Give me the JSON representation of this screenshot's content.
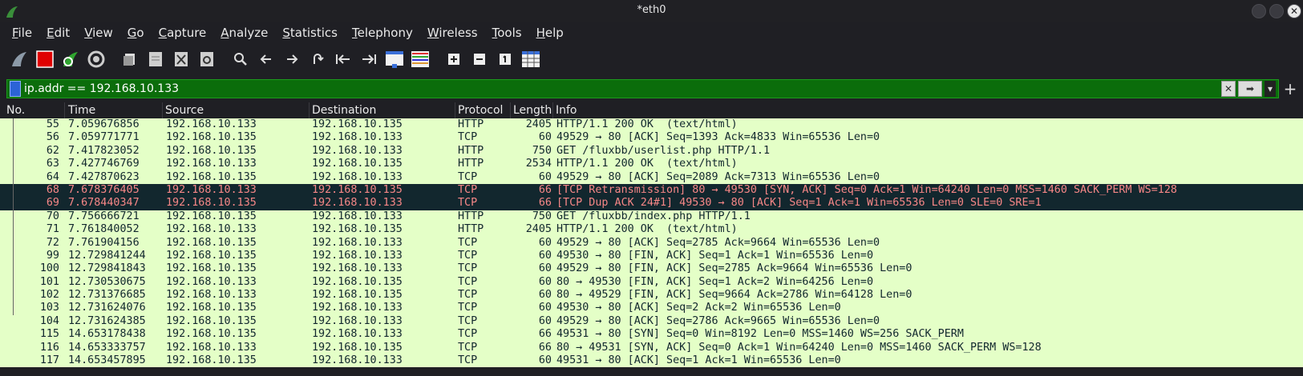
{
  "window": {
    "title": "*eth0"
  },
  "menu": [
    "File",
    "Edit",
    "View",
    "Go",
    "Capture",
    "Analyze",
    "Statistics",
    "Telephony",
    "Wireless",
    "Tools",
    "Help"
  ],
  "toolbar_icons": [
    "shark-fin-start-icon",
    "stop-capture-icon",
    "restart-capture-icon",
    "capture-options-icon",
    "open-file-icon",
    "save-file-icon",
    "close-file-icon",
    "reload-file-icon",
    "find-packet-icon",
    "go-back-icon",
    "go-forward-icon",
    "go-to-packet-icon",
    "first-packet-icon",
    "last-packet-icon",
    "autoscroll-icon",
    "colorize-icon",
    "zoom-in-icon",
    "zoom-out-icon",
    "normal-size-icon",
    "resize-columns-icon"
  ],
  "filter": {
    "value": "ip.addr == 192.168.10.133"
  },
  "columns": [
    "No.",
    "Time",
    "Source",
    "Destination",
    "Protocol",
    "Length",
    "Info"
  ],
  "colors": {
    "row_bg": "#e4ffc7",
    "row_fg": "#12272e",
    "bad_bg": "#12272e",
    "bad_fg": "#f78787",
    "filter_ok": "#0b6d0b"
  },
  "packets": [
    {
      "no": "55",
      "time": "7.059676856",
      "src": "192.168.10.133",
      "dst": "192.168.10.135",
      "proto": "HTTP",
      "len": "2405",
      "info": "HTTP/1.1 200 OK  (text/html)",
      "bad": false
    },
    {
      "no": "56",
      "time": "7.059771771",
      "src": "192.168.10.135",
      "dst": "192.168.10.133",
      "proto": "TCP",
      "len": "60",
      "info": "49529 → 80 [ACK] Seq=1393 Ack=4833 Win=65536 Len=0",
      "bad": false
    },
    {
      "no": "62",
      "time": "7.417823052",
      "src": "192.168.10.135",
      "dst": "192.168.10.133",
      "proto": "HTTP",
      "len": "750",
      "info": "GET /fluxbb/userlist.php HTTP/1.1",
      "bad": false
    },
    {
      "no": "63",
      "time": "7.427746769",
      "src": "192.168.10.133",
      "dst": "192.168.10.135",
      "proto": "HTTP",
      "len": "2534",
      "info": "HTTP/1.1 200 OK  (text/html)",
      "bad": false
    },
    {
      "no": "64",
      "time": "7.427870623",
      "src": "192.168.10.135",
      "dst": "192.168.10.133",
      "proto": "TCP",
      "len": "60",
      "info": "49529 → 80 [ACK] Seq=2089 Ack=7313 Win=65536 Len=0",
      "bad": false
    },
    {
      "no": "68",
      "time": "7.678376405",
      "src": "192.168.10.133",
      "dst": "192.168.10.135",
      "proto": "TCP",
      "len": "66",
      "info": "[TCP Retransmission] 80 → 49530 [SYN, ACK] Seq=0 Ack=1 Win=64240 Len=0 MSS=1460 SACK_PERM WS=128",
      "bad": true
    },
    {
      "no": "69",
      "time": "7.678440347",
      "src": "192.168.10.135",
      "dst": "192.168.10.133",
      "proto": "TCP",
      "len": "66",
      "info": "[TCP Dup ACK 24#1] 49530 → 80 [ACK] Seq=1 Ack=1 Win=65536 Len=0 SLE=0 SRE=1",
      "bad": true
    },
    {
      "no": "70",
      "time": "7.756666721",
      "src": "192.168.10.135",
      "dst": "192.168.10.133",
      "proto": "HTTP",
      "len": "750",
      "info": "GET /fluxbb/index.php HTTP/1.1",
      "bad": false
    },
    {
      "no": "71",
      "time": "7.761840052",
      "src": "192.168.10.133",
      "dst": "192.168.10.135",
      "proto": "HTTP",
      "len": "2405",
      "info": "HTTP/1.1 200 OK  (text/html)",
      "bad": false
    },
    {
      "no": "72",
      "time": "7.761904156",
      "src": "192.168.10.135",
      "dst": "192.168.10.133",
      "proto": "TCP",
      "len": "60",
      "info": "49529 → 80 [ACK] Seq=2785 Ack=9664 Win=65536 Len=0",
      "bad": false
    },
    {
      "no": "99",
      "time": "12.729841244",
      "src": "192.168.10.135",
      "dst": "192.168.10.133",
      "proto": "TCP",
      "len": "60",
      "info": "49530 → 80 [FIN, ACK] Seq=1 Ack=1 Win=65536 Len=0",
      "bad": false
    },
    {
      "no": "100",
      "time": "12.729841843",
      "src": "192.168.10.135",
      "dst": "192.168.10.133",
      "proto": "TCP",
      "len": "60",
      "info": "49529 → 80 [FIN, ACK] Seq=2785 Ack=9664 Win=65536 Len=0",
      "bad": false
    },
    {
      "no": "101",
      "time": "12.730530675",
      "src": "192.168.10.133",
      "dst": "192.168.10.135",
      "proto": "TCP",
      "len": "60",
      "info": "80 → 49530 [FIN, ACK] Seq=1 Ack=2 Win=64256 Len=0",
      "bad": false
    },
    {
      "no": "102",
      "time": "12.731376685",
      "src": "192.168.10.133",
      "dst": "192.168.10.135",
      "proto": "TCP",
      "len": "60",
      "info": "80 → 49529 [FIN, ACK] Seq=9664 Ack=2786 Win=64128 Len=0",
      "bad": false
    },
    {
      "no": "103",
      "time": "12.731624076",
      "src": "192.168.10.135",
      "dst": "192.168.10.133",
      "proto": "TCP",
      "len": "60",
      "info": "49530 → 80 [ACK] Seq=2 Ack=2 Win=65536 Len=0",
      "bad": false
    },
    {
      "no": "104",
      "time": "12.731624385",
      "src": "192.168.10.135",
      "dst": "192.168.10.133",
      "proto": "TCP",
      "len": "60",
      "info": "49529 → 80 [ACK] Seq=2786 Ack=9665 Win=65536 Len=0",
      "bad": false
    },
    {
      "no": "115",
      "time": "14.653178438",
      "src": "192.168.10.135",
      "dst": "192.168.10.133",
      "proto": "TCP",
      "len": "66",
      "info": "49531 → 80 [SYN] Seq=0 Win=8192 Len=0 MSS=1460 WS=256 SACK_PERM",
      "bad": false
    },
    {
      "no": "116",
      "time": "14.653333757",
      "src": "192.168.10.133",
      "dst": "192.168.10.135",
      "proto": "TCP",
      "len": "66",
      "info": "80 → 49531 [SYN, ACK] Seq=0 Ack=1 Win=64240 Len=0 MSS=1460 SACK_PERM WS=128",
      "bad": false
    },
    {
      "no": "117",
      "time": "14.653457895",
      "src": "192.168.10.135",
      "dst": "192.168.10.133",
      "proto": "TCP",
      "len": "60",
      "info": "49531 → 80 [ACK] Seq=1 Ack=1 Win=65536 Len=0",
      "bad": false
    }
  ]
}
